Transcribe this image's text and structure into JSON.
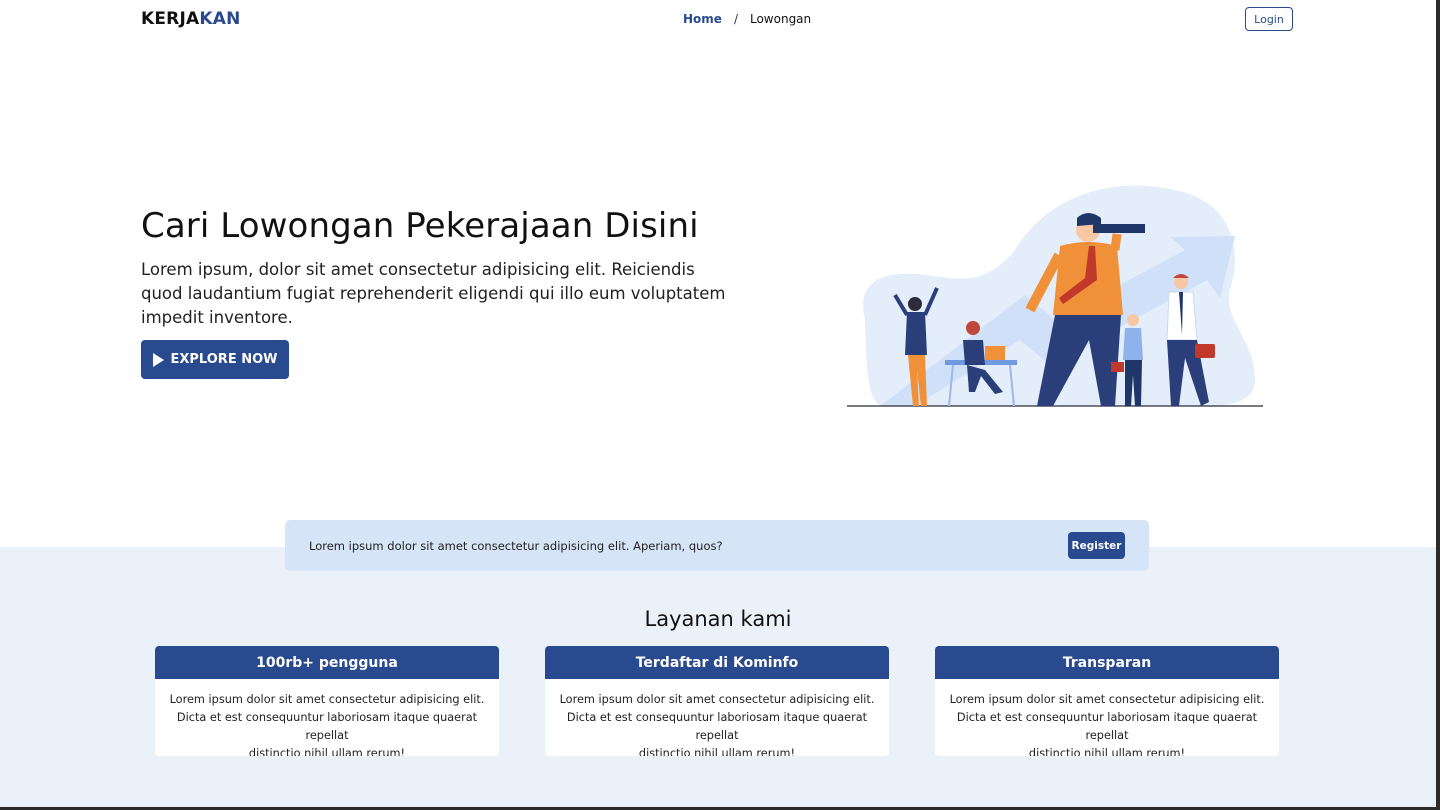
{
  "navbar": {
    "logo_part1": "KERJA",
    "logo_part2": "KAN",
    "breadcrumb": {
      "home": "Home",
      "separator": "/",
      "current": "Lowongan"
    },
    "login_label": "Login"
  },
  "hero": {
    "title": "Cari Lowongan Pekerajaan Disini",
    "description": "Lorem ipsum, dolor sit amet consectetur adipisicing elit. Reiciendis quod laudantium fugiat reprehenderit eligendi qui illo eum voluptatem impedit inventore.",
    "cta_label": "EXPLORE NOW",
    "cta_icon": "play-icon"
  },
  "banner": {
    "text": "Lorem ipsum dolor sit amet consectetur adipisicing elit. Aperiam, quos?",
    "button_label": "Register"
  },
  "services": {
    "title": "Layanan kami",
    "cards": [
      {
        "title": "100rb+ pengguna",
        "line1": "Lorem ipsum dolor sit amet consectetur adipisicing elit.",
        "line2": "Dicta et est consequuntur laboriosam itaque quaerat repellat",
        "line3": "distinctio nihil ullam rerum!"
      },
      {
        "title": "Terdaftar di Kominfo",
        "line1": "Lorem ipsum dolor sit amet consectetur adipisicing elit.",
        "line2": "Dicta et est consequuntur laboriosam itaque quaerat repellat",
        "line3": "distinctio nihil ullam rerum!"
      },
      {
        "title": "Transparan",
        "line1": "Lorem ipsum dolor sit amet consectetur adipisicing elit.",
        "line2": "Dicta et est consequuntur laboriosam itaque quaerat repellat",
        "line3": "distinctio nihil ullam rerum!"
      }
    ]
  },
  "colors": {
    "primary": "#2a4a8f",
    "banner_bg": "#d6e4f7",
    "section_bg": "#eaf1f9",
    "accent_orange": "#f0913a"
  }
}
